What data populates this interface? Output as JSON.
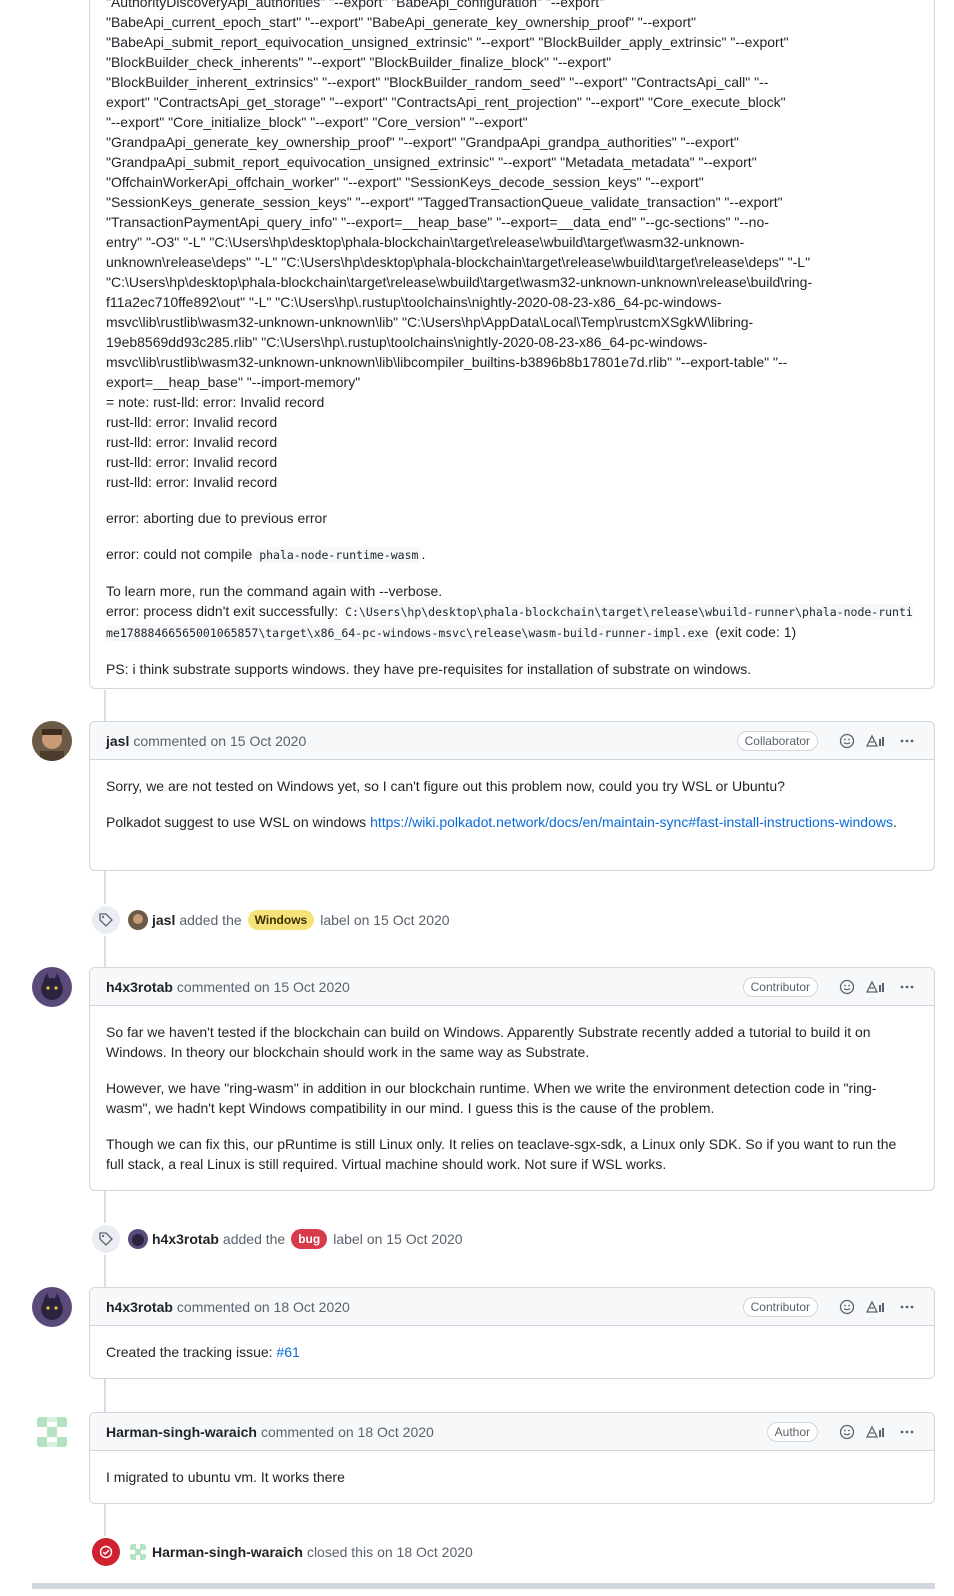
{
  "first_comment": {
    "log_lines": "\"AuthorityDiscoveryApi_authorities\" \"--export\" \"BabeApi_configuration\" \"--export\"\n\"BabeApi_current_epoch_start\" \"--export\" \"BabeApi_generate_key_ownership_proof\" \"--export\"\n\"BabeApi_submit_report_equivocation_unsigned_extrinsic\" \"--export\" \"BlockBuilder_apply_extrinsic\" \"--export\"\n\"BlockBuilder_check_inherents\" \"--export\" \"BlockBuilder_finalize_block\" \"--export\"\n\"BlockBuilder_inherent_extrinsics\" \"--export\" \"BlockBuilder_random_seed\" \"--export\" \"ContractsApi_call\" \"--\nexport\" \"ContractsApi_get_storage\" \"--export\" \"ContractsApi_rent_projection\" \"--export\" \"Core_execute_block\"\n\"--export\" \"Core_initialize_block\" \"--export\" \"Core_version\" \"--export\"\n\"GrandpaApi_generate_key_ownership_proof\" \"--export\" \"GrandpaApi_grandpa_authorities\" \"--export\"\n\"GrandpaApi_submit_report_equivocation_unsigned_extrinsic\" \"--export\" \"Metadata_metadata\" \"--export\"\n\"OffchainWorkerApi_offchain_worker\" \"--export\" \"SessionKeys_decode_session_keys\" \"--export\"\n\"SessionKeys_generate_session_keys\" \"--export\" \"TaggedTransactionQueue_validate_transaction\" \"--export\"\n\"TransactionPaymentApi_query_info\" \"--export=__heap_base\" \"--export=__data_end\" \"--gc-sections\" \"--no-\nentry\" \"-O3\" \"-L\" \"C:\\Users\\hp\\desktop\\phala-blockchain\\target\\release\\wbuild\\target\\wasm32-unknown-\nunknown\\release\\deps\" \"-L\" \"C:\\Users\\hp\\desktop\\phala-blockchain\\target\\release\\wbuild\\target\\release\\deps\" \"-L\"\n\"C:\\Users\\hp\\desktop\\phala-blockchain\\target\\release\\wbuild\\target\\wasm32-unknown-unknown\\release\\build\\ring-\nf11a2ec710ffe892\\out\" \"-L\" \"C:\\Users\\hp\\.rustup\\toolchains\\nightly-2020-08-23-x86_64-pc-windows-\nmsvc\\lib\\rustlib\\wasm32-unknown-unknown\\lib\" \"C:\\Users\\hp\\AppData\\Local\\Temp\\rustcmXSgkW\\libring-\n19eb8569dd93c285.rlib\" \"C:\\Users\\hp\\.rustup\\toolchains\\nightly-2020-08-23-x86_64-pc-windows-\nmsvc\\lib\\rustlib\\wasm32-unknown-unknown\\lib\\libcompiler_builtins-b3896b8b17801e7d.rlib\" \"--export-table\" \"--\nexport=__heap_base\" \"--import-memory\"\n= note: rust-lld: error: Invalid record\nrust-lld: error: Invalid record\nrust-lld: error: Invalid record\nrust-lld: error: Invalid record\nrust-lld: error: Invalid record",
    "abort": "error: aborting due to previous error",
    "compile_prefix": "error: could not compile",
    "compile_code": "phala-node-runtime-wasm",
    "compile_suffix": ".",
    "learn_more": "To learn more, run the command again with --verbose.",
    "exit_prefix": "error: process didn't exit successfully:",
    "exit_code_path": "C:\\Users\\hp\\desktop\\phala-blockchain\\target\\release\\wbuild-runner\\phala-node-runtime17888466565001065857\\target\\x86_64-pc-windows-msvc\\release\\wasm-build-runner-impl.exe",
    "exit_suffix": "(exit code: 1)",
    "ps": "PS: i think substrate supports windows. they have pre-requisites for installation of substrate on windows."
  },
  "comments": [
    {
      "author": "jasl",
      "action": "commented",
      "date": "on 15 Oct 2020",
      "role": "Collaborator",
      "p1": "Sorry, we are not tested on Windows yet, so I can't figure out this problem now, could you try WSL or Ubuntu?",
      "p2_prefix": "Polkadot suggest to use WSL on windows",
      "p2_link": "https://wiki.polkadot.network/docs/en/maintain-sync#fast-install-instructions-windows",
      "p2_suffix": "."
    },
    {
      "author": "h4x3rotab",
      "action": "commented",
      "date": "on 15 Oct 2020",
      "role": "Contributor",
      "p1": "So far we haven't tested if the blockchain can build on Windows. Apparently Substrate recently added a tutorial to build it on Windows. In theory our blockchain should work in the same way as Substrate.",
      "p2": "However, we have \"ring-wasm\" in addition in our blockchain runtime. When we write the environment detection code in \"ring-wasm\", we hadn't kept Windows compatibility in our mind. I guess this is the cause of the problem.",
      "p3": "Though we can fix this, our pRuntime is still Linux only. It relies on teaclave-sgx-sdk, a Linux only SDK. So if you want to run the full stack, a real Linux is still required. Virtual machine should work. Not sure if WSL works."
    },
    {
      "author": "h4x3rotab",
      "action": "commented",
      "date": "on 18 Oct 2020",
      "role": "Contributor",
      "p1_prefix": "Created the tracking issue:",
      "p1_link": "#61"
    },
    {
      "author": "Harman-singh-waraich",
      "action": "commented",
      "date": "on 18 Oct 2020",
      "role": "Author",
      "p1": "I migrated to ubuntu vm. It works there"
    }
  ],
  "events": [
    {
      "actor": "jasl",
      "verb": "added the",
      "label": "Windows",
      "label_bg": "#f5e37a",
      "label_fg": "#3a3000",
      "suffix": "label",
      "date": "on 15 Oct 2020"
    },
    {
      "actor": "h4x3rotab",
      "verb": "added the",
      "label": "bug",
      "label_bg": "#d73a4a",
      "label_fg": "#ffffff",
      "suffix": "label",
      "date": "on 15 Oct 2020"
    },
    {
      "actor": "Harman-singh-waraich",
      "verb": "closed this",
      "date": "on 18 Oct 2020"
    }
  ],
  "colors": {
    "link": "#0969da",
    "closed_icon": "#cf222e",
    "border": "#d0d7de"
  },
  "icons": {
    "reaction": "smiley-icon",
    "translate": "translate-icon",
    "more": "kebab-horizontal-icon",
    "label_event": "tag-icon",
    "closed_event": "check-circle-icon"
  }
}
